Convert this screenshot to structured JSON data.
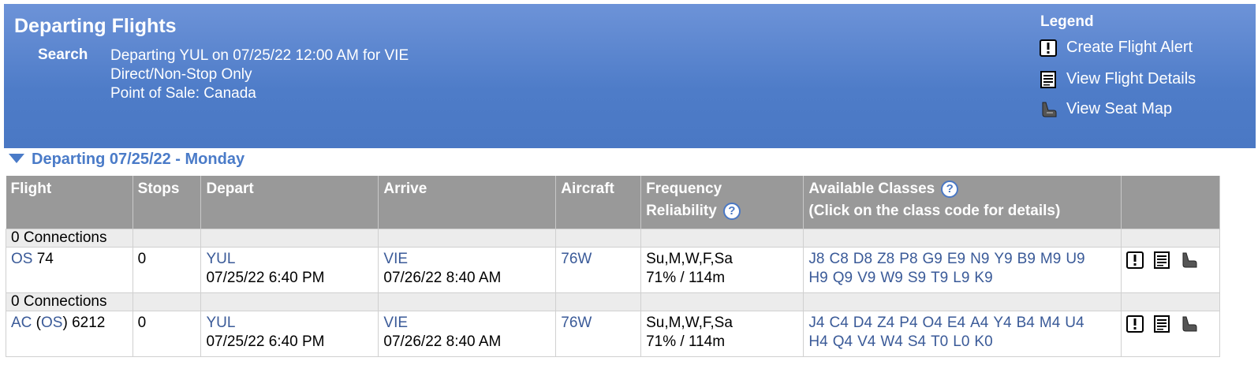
{
  "header": {
    "title": "Departing Flights",
    "search_label": "Search",
    "search_lines": [
      "Departing YUL on 07/25/22 12:00 AM for VIE",
      "Direct/Non-Stop Only",
      "Point of Sale: Canada"
    ],
    "legend_title": "Legend",
    "legend": [
      {
        "label": "Create Flight Alert",
        "icon": "alert-icon"
      },
      {
        "label": "View Flight Details",
        "icon": "details-icon"
      },
      {
        "label": "View Seat Map",
        "icon": "seat-icon"
      }
    ]
  },
  "section": {
    "title": "Departing 07/25/22 - Monday"
  },
  "columns": {
    "flight": "Flight",
    "stops": "Stops",
    "depart": "Depart",
    "arrive": "Arrive",
    "aircraft": "Aircraft",
    "frequency": "Frequency",
    "reliability": "Reliability",
    "classes": "Available Classes",
    "classes_hint": "(Click on the class code for details)"
  },
  "rows": [
    {
      "connections": "0 Connections",
      "flight_pre": "",
      "airline": "OS",
      "flight_mid": "",
      "operating": "",
      "flight_num": " 74",
      "stops": "0",
      "dep_code": "YUL",
      "dep_time": "07/25/22 6:40 PM",
      "arr_code": "VIE",
      "arr_time": "07/26/22 8:40 AM",
      "aircraft": "76W",
      "frequency": "Su,M,W,F,Sa",
      "reliability": "71% / 114m",
      "classes_line1": [
        "J8",
        "C8",
        "D8",
        "Z8",
        "P8",
        "G9",
        "E9",
        "N9",
        "Y9",
        "B9",
        "M9",
        "U9"
      ],
      "classes_line2": [
        "H9",
        "Q9",
        "V9",
        "W9",
        "S9",
        "T9",
        "L9",
        "K9"
      ]
    },
    {
      "connections": "0 Connections",
      "airline": "AC",
      "operating": "OS",
      "flight_num": " 6212",
      "stops": "0",
      "dep_code": "YUL",
      "dep_time": "07/25/22 6:40 PM",
      "arr_code": "VIE",
      "arr_time": "07/26/22 8:40 AM",
      "aircraft": "76W",
      "frequency": "Su,M,W,F,Sa",
      "reliability": "71% / 114m",
      "classes_line1": [
        "J4",
        "C4",
        "D4",
        "Z4",
        "P4",
        "O4",
        "E4",
        "A4",
        "Y4",
        "B4",
        "M4",
        "U4"
      ],
      "classes_line2": [
        "H4",
        "Q4",
        "V4",
        "W4",
        "S4",
        "T0",
        "L0",
        "K0"
      ]
    }
  ]
}
